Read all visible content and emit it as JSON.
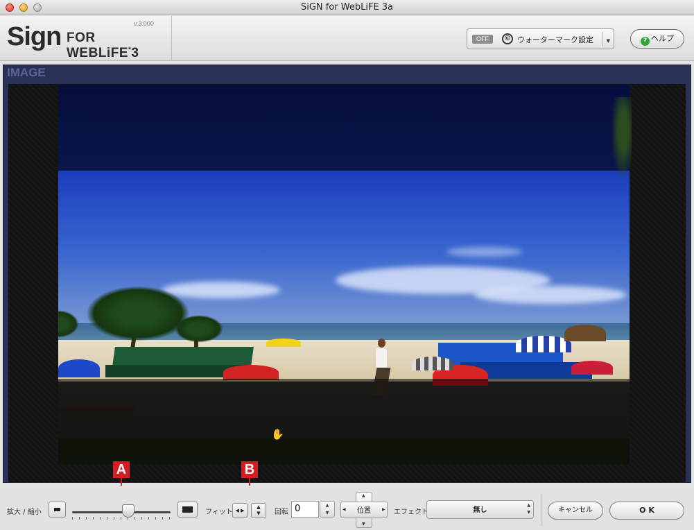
{
  "window": {
    "title": "SiGN for WebLiFE 3a"
  },
  "header": {
    "logo_main": "Sign",
    "logo_sub": "FOR WEBLiFE",
    "logo_sup": "*",
    "logo_num": "3",
    "version": "v.3.000",
    "watermark": {
      "toggle": "OFF",
      "symbol": "©",
      "label": "ウォーターマーク設定"
    },
    "help_label": "ヘルプ"
  },
  "image_panel": {
    "tab_label": "IMAGE"
  },
  "callouts": {
    "a": "A",
    "b": "B"
  },
  "toolbar": {
    "zoom_label": "拡大 / 縮小",
    "zoom_level": 0.57,
    "fit_label": "フィット",
    "rotate_label": "回転",
    "rotate_value": "0",
    "position_label": "位置",
    "effect_label": "エフェクト",
    "effect_value": "無し",
    "cancel_label": "キャンセル",
    "ok_label": "O K"
  },
  "colors": {
    "accent_red": "#d51d24",
    "panel_blue": "#2a3156"
  }
}
